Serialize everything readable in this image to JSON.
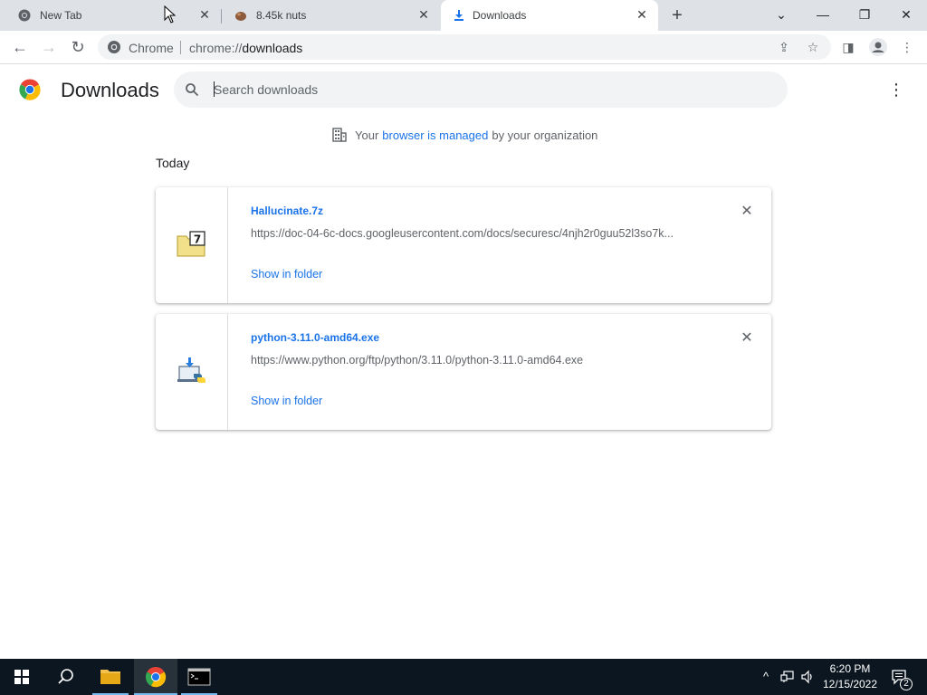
{
  "tabs": [
    {
      "title": "New Tab",
      "favicon": "chrome-icon",
      "active": false
    },
    {
      "title": "8.45k nuts",
      "favicon": "nut-icon",
      "active": false
    },
    {
      "title": "Downloads",
      "favicon": "download-icon",
      "active": true
    }
  ],
  "omnibox": {
    "site_chip": "Chrome",
    "url_scheme": "chrome://",
    "url_path": "downloads"
  },
  "page": {
    "heading": "Downloads",
    "search_placeholder": "Search downloads",
    "managed_prefix": "Your",
    "managed_link": "browser is managed",
    "managed_suffix": "by your organization",
    "section_label": "Today"
  },
  "downloads": [
    {
      "name": "Hallucinate.7z",
      "url": "https://doc-04-6c-docs.googleusercontent.com/docs/securesc/4njh2r0guu52l3so7k...",
      "action": "Show in folder",
      "icon": "7zip-archive-icon"
    },
    {
      "name": "python-3.11.0-amd64.exe",
      "url": "https://www.python.org/ftp/python/3.11.0/python-3.11.0-amd64.exe",
      "action": "Show in folder",
      "icon": "python-installer-icon"
    }
  ],
  "taskbar": {
    "time": "6:20 PM",
    "date": "12/15/2022",
    "notification_count": "2"
  },
  "colors": {
    "accent": "#1a73e8",
    "tabstrip": "#dee1e6",
    "taskbar": "#0b1620"
  }
}
